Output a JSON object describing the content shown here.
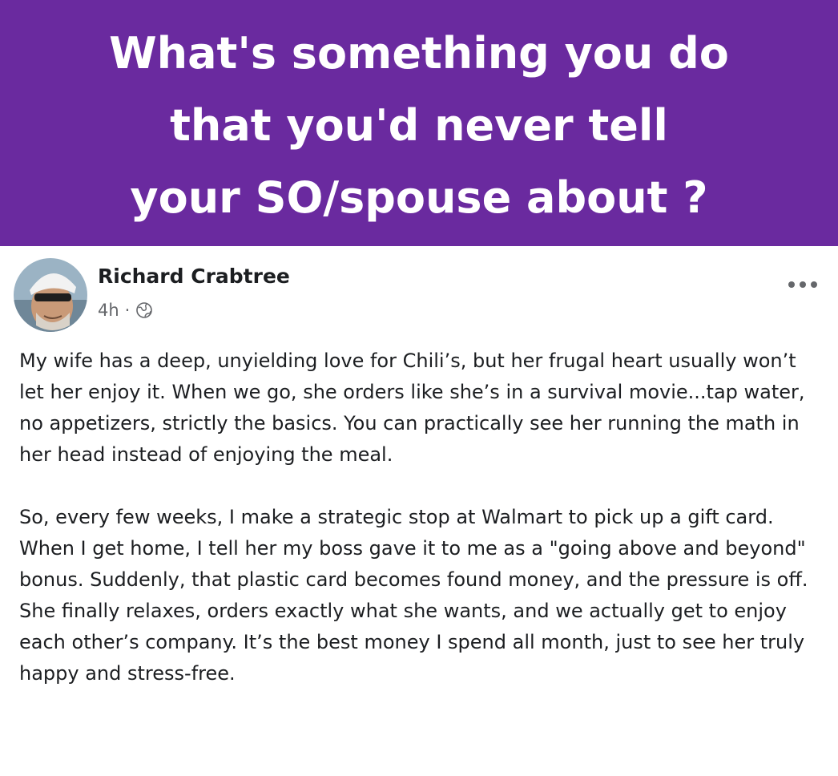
{
  "banner": {
    "title_lines": [
      "What's something you do",
      "that you'd never tell",
      "your SO/spouse about ?"
    ],
    "background_color": "#6a2a9f",
    "text_color": "#ffffff"
  },
  "post": {
    "author": {
      "name": "Richard Crabtree",
      "avatar_icon": "profile-photo"
    },
    "timestamp": "4h",
    "separator": "·",
    "audience_icon": "globe-icon",
    "menu_icon": "more-options-icon",
    "paragraphs": [
      "My wife has a deep, unyielding love for Chili’s, but her frugal heart usually won’t let her enjoy it. When we go, she orders like she’s in a survival movie...tap water, no appetizers, strictly the basics. You can practically see her running the math in her head instead of enjoying the meal.",
      "So, every few weeks, I make a strategic stop at Walmart to pick up a gift card. When I get home, I tell her my boss gave it to me as a \"going above and beyond\" bonus. Suddenly, that plastic card becomes found money, and the pressure is off. She finally relaxes, orders exactly what she wants, and we actually get to enjoy each other’s company. It’s the best money I spend all month, just to see her truly happy and stress-free."
    ]
  }
}
